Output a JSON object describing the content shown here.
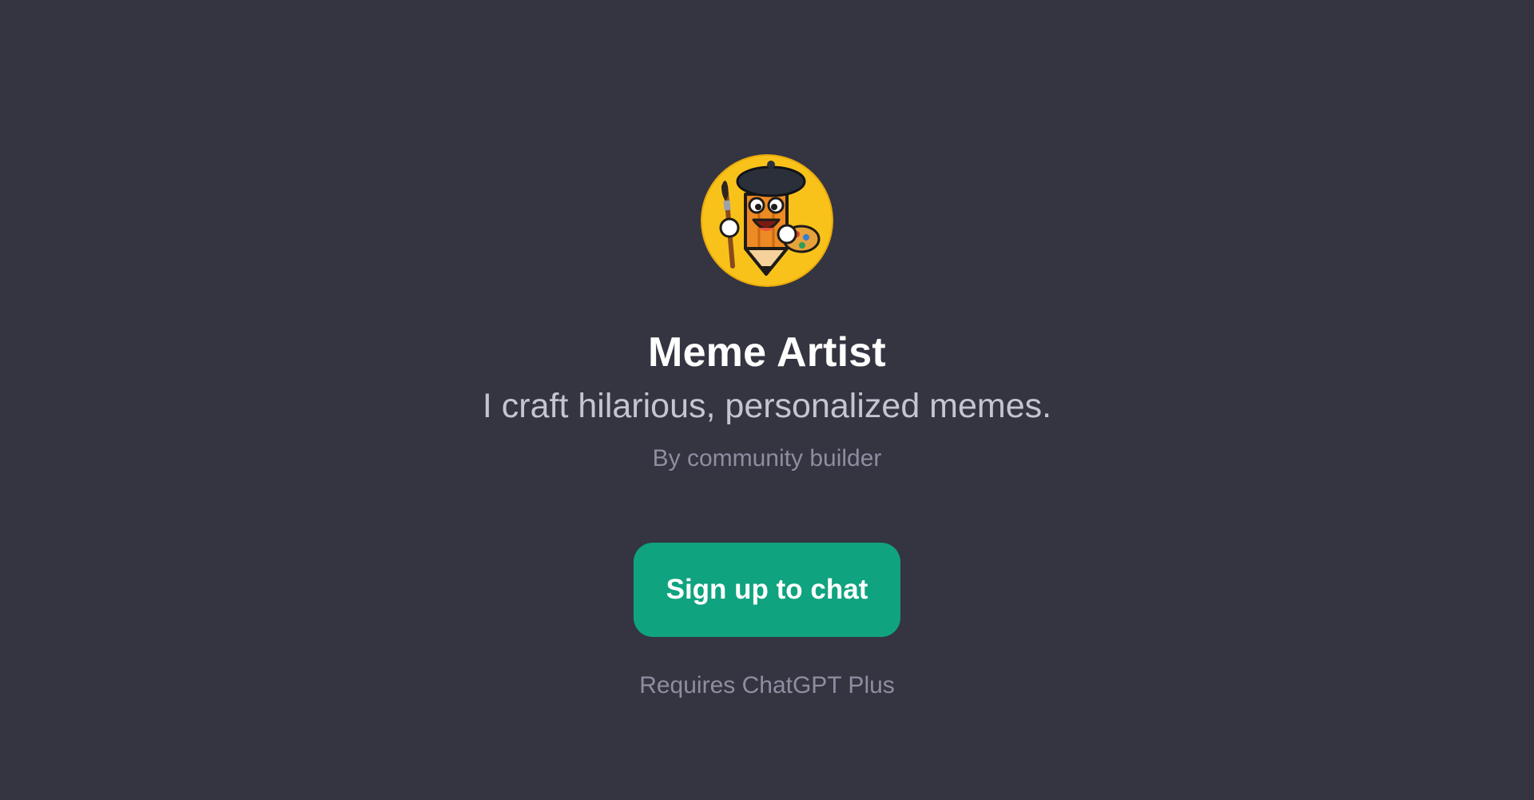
{
  "gpt": {
    "avatar_icon": "pencil-artist-mascot-icon",
    "title": "Meme Artist",
    "description": "I craft hilarious, personalized memes.",
    "byline": "By community builder"
  },
  "cta": {
    "label": "Sign up to chat",
    "note": "Requires ChatGPT Plus"
  },
  "colors": {
    "background": "#343541",
    "accent": "#10a37f",
    "avatar_background": "#f8c21a"
  }
}
